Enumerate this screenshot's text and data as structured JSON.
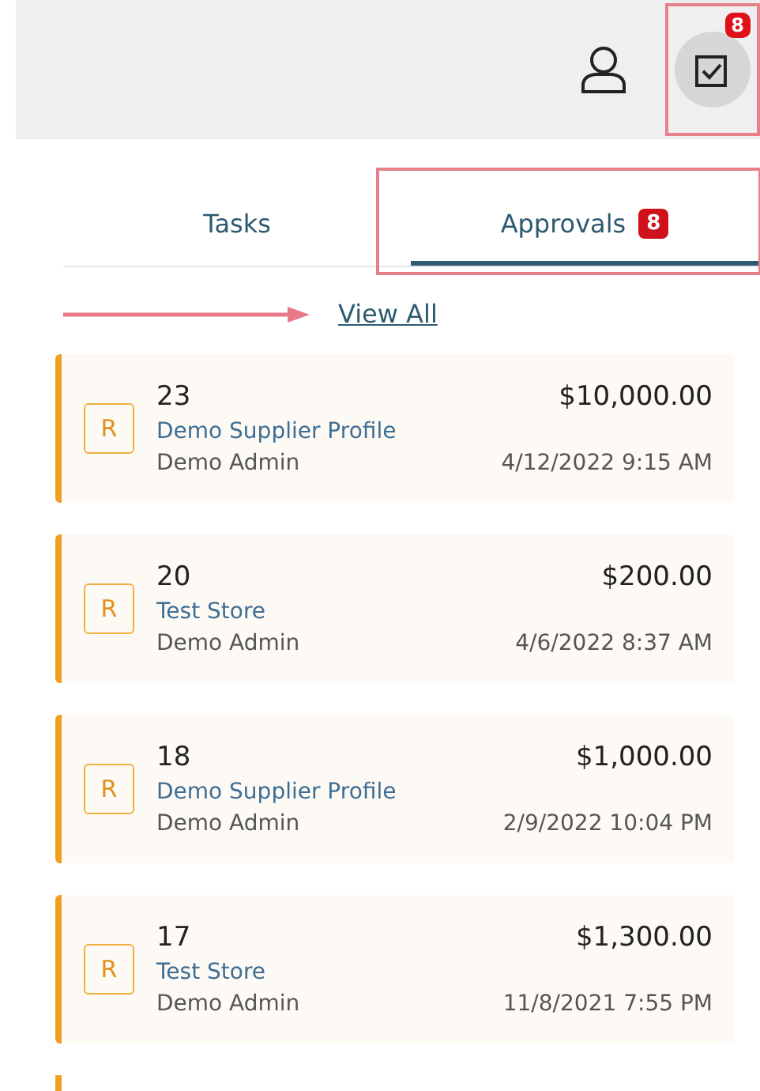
{
  "header": {
    "tasks_badge": "8"
  },
  "tabs": [
    {
      "label": "Tasks",
      "selected": false
    },
    {
      "label": "Approvals",
      "selected": true,
      "badge": "8"
    }
  ],
  "view_all": "View All",
  "approvals": [
    {
      "initial": "R",
      "id": "23",
      "amount": "$10,000.00",
      "source": "Demo Supplier Profile",
      "user": "Demo Admin",
      "date": "4/12/2022 9:15 AM"
    },
    {
      "initial": "R",
      "id": "20",
      "amount": "$200.00",
      "source": "Test Store",
      "user": "Demo Admin",
      "date": "4/6/2022 8:37 AM"
    },
    {
      "initial": "R",
      "id": "18",
      "amount": "$1,000.00",
      "source": "Demo Supplier Profile",
      "user": "Demo Admin",
      "date": "2/9/2022 10:04 PM"
    },
    {
      "initial": "R",
      "id": "17",
      "amount": "$1,300.00",
      "source": "Test Store",
      "user": "Demo Admin",
      "date": "11/8/2021 7:55 PM"
    }
  ]
}
